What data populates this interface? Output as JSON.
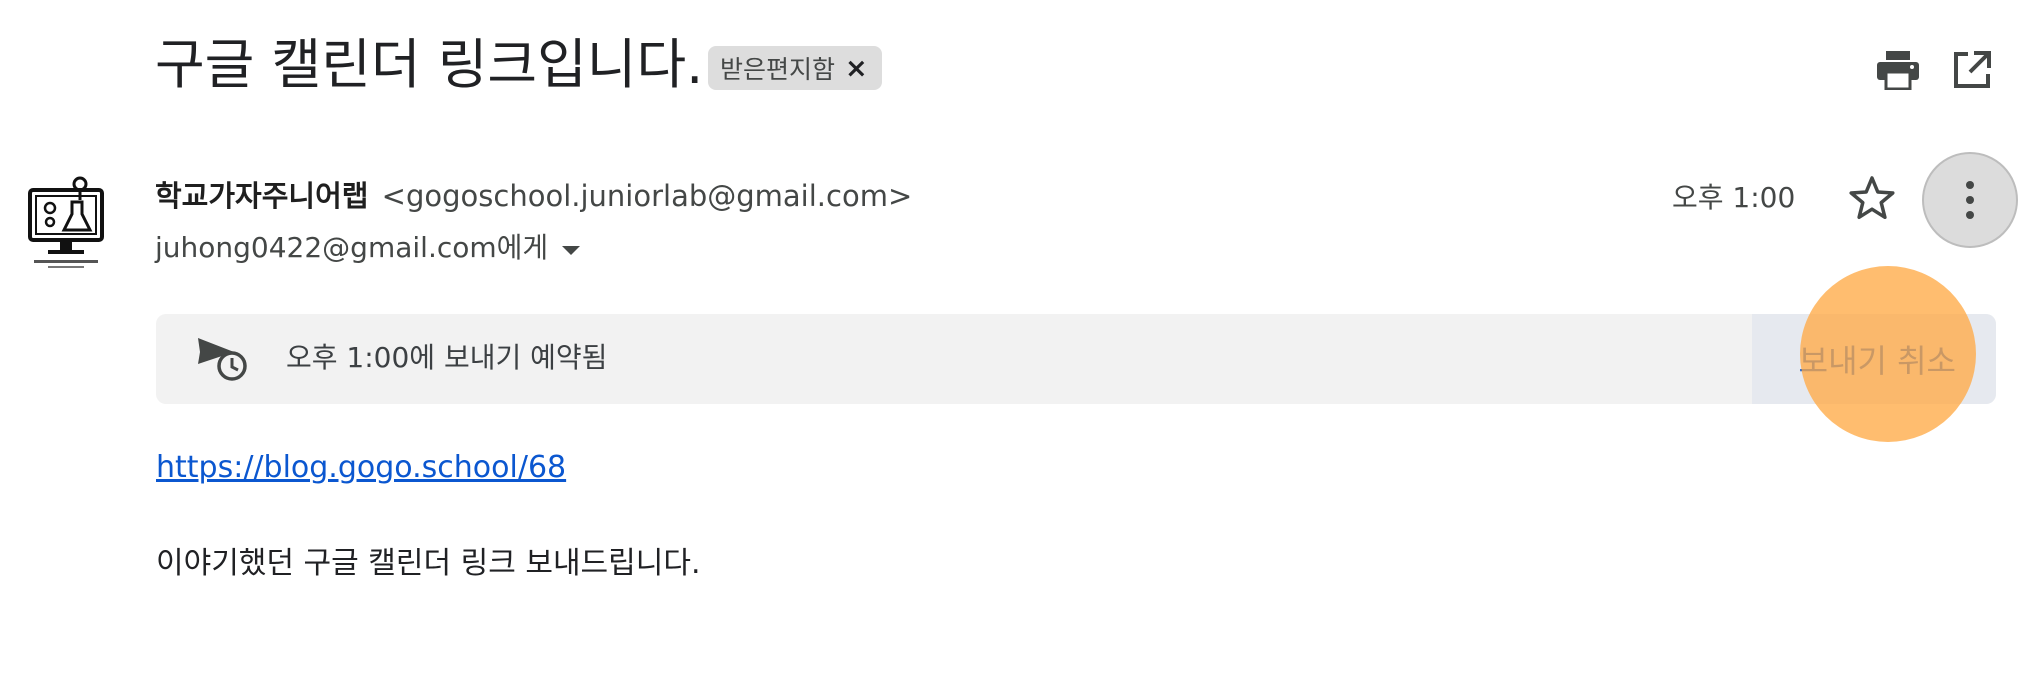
{
  "email": {
    "subject": "구글 캘린더 링크입니다.",
    "label": {
      "text": "받은편지함",
      "remove_glyph": "×"
    },
    "toolbar": {
      "print_icon": "print-icon",
      "open_new_window_icon": "open-in-new-icon"
    },
    "sender": {
      "name": "학교가자주니어랩",
      "email": "<gogoschool.juniorlab@gmail.com>",
      "avatar_icon": "lab-computer-logo"
    },
    "recipient": {
      "text": "juhong0422@gmail.com에게"
    },
    "time": "오후 1:00",
    "schedule_notice": {
      "text": "오후 1:00에 보내기 예약됨",
      "cancel_label": "보내기 취소",
      "icon": "scheduled-send-icon"
    },
    "body": {
      "link": "https://blog.gogo.school/68",
      "text": "이야기했던 구글 캘린더 링크 보내드립니다."
    }
  },
  "colors": {
    "link": "#0b57d0",
    "chip_bg": "#dddddd",
    "schedule_bar_bg": "#f2f2f2",
    "cancel_bg": "#e6e9ef",
    "click_highlight": "#ffaa46"
  }
}
